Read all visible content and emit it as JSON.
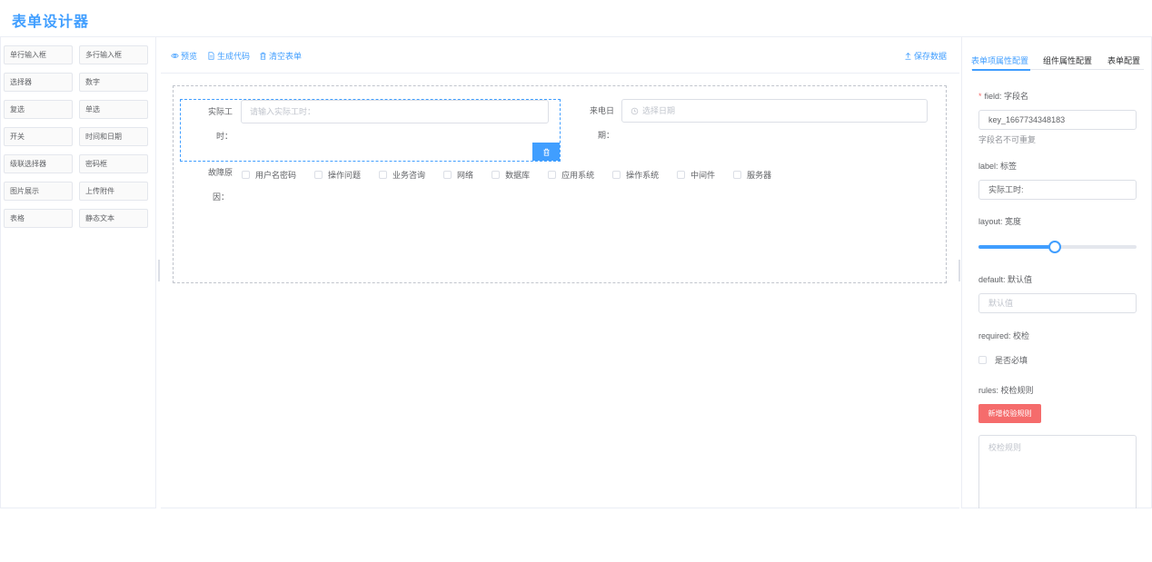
{
  "app": {
    "title": "表单设计器"
  },
  "palette": {
    "items": [
      "单行输入框",
      "多行输入框",
      "选择器",
      "数字",
      "复选",
      "单选",
      "开关",
      "时间和日期",
      "级联选择器",
      "密码框",
      "图片展示",
      "上传附件",
      "表格",
      "静态文本"
    ]
  },
  "toolbar": {
    "preview_label": "预览",
    "generate_code_label": "生成代码",
    "clear_form_label": "清空表单",
    "save_data_label": "保存数据"
  },
  "form": {
    "actual_hours": {
      "label_line1": "实际工",
      "label_line2": "时：",
      "placeholder": "请输入实际工时："
    },
    "call_date": {
      "label_line1": "来电日",
      "label_line2": "期：",
      "placeholder": "选择日期"
    },
    "fault_cause": {
      "label_line1": "故障原",
      "label_line2": "因：",
      "options": [
        "用户名密码",
        "操作问题",
        "业务咨询",
        "网络",
        "数据库",
        "应用系统",
        "操作系统",
        "中间件",
        "服务器"
      ]
    }
  },
  "panel": {
    "tabs": [
      "表单项属性配置",
      "组件属性配置",
      "表单配置"
    ],
    "active_tab": 0,
    "field_label": "field: 字段名",
    "field_required_mark": "*",
    "field_value": "key_1667734348183",
    "field_hint": "字段名不可重复",
    "label_label": "label: 标签",
    "label_value": "实际工时:",
    "layout_label": "layout: 宽度",
    "layout_value": 0.48,
    "default_label": "default: 默认值",
    "default_placeholder": "默认值",
    "required_label": "required: 校检",
    "required_check_label": "是否必填",
    "rules_label": "rules: 校检规则",
    "add_rule_label": "新增校验规则",
    "rules_placeholder": "校检规则"
  },
  "colors": {
    "primary": "#409eff",
    "danger": "#f56c6c",
    "border": "#dcdfe6"
  }
}
